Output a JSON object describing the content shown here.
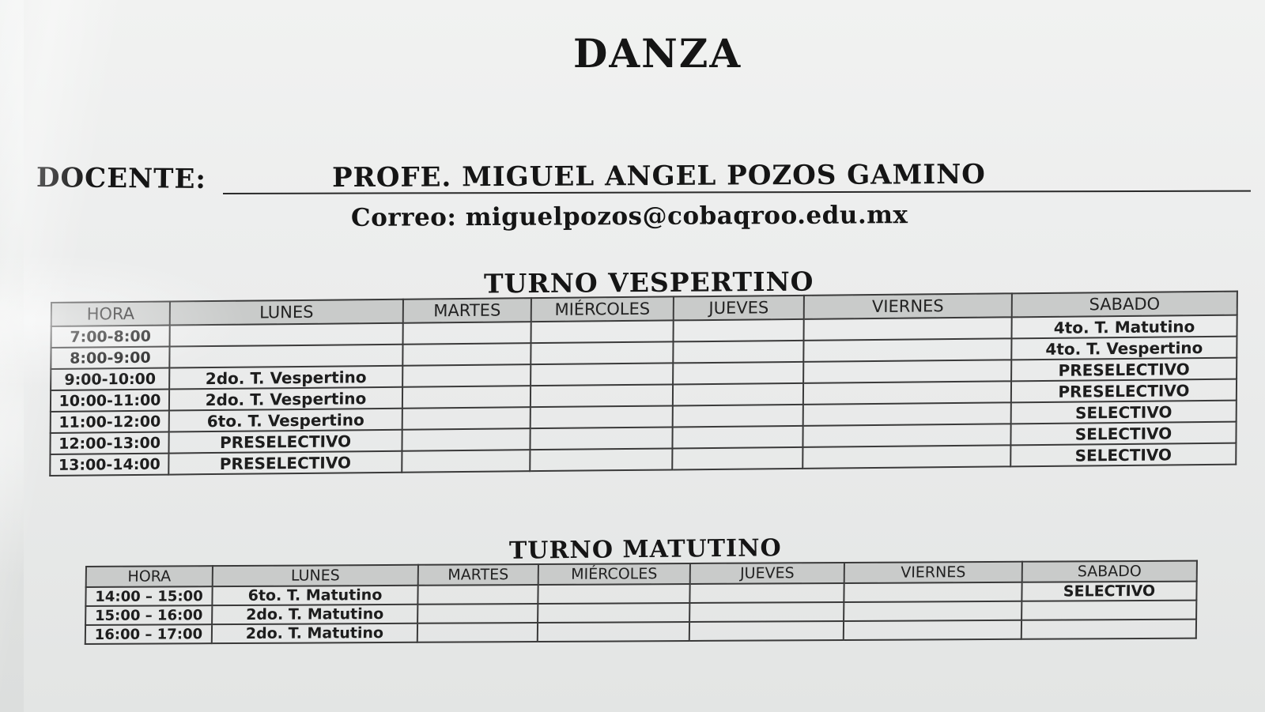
{
  "title": "DANZA",
  "docente": {
    "label": "DOCENTE:",
    "name": "PROFE. MIGUEL ANGEL POZOS GAMINO",
    "email_line": "Correo: miguelpozos@cobaqroo.edu.mx"
  },
  "vespertino": {
    "heading": "TURNO VESPERTINO",
    "headers": [
      "HORA",
      "LUNES",
      "MARTES",
      "MIÉRCOLES",
      "JUEVES",
      "VIERNES",
      "SABADO"
    ],
    "rows": [
      [
        "7:00-8:00",
        "",
        "",
        "",
        "",
        "",
        "4to. T. Matutino"
      ],
      [
        "8:00-9:00",
        "",
        "",
        "",
        "",
        "",
        "4to. T. Vespertino"
      ],
      [
        "9:00-10:00",
        "2do. T. Vespertino",
        "",
        "",
        "",
        "",
        "PRESELECTIVO"
      ],
      [
        "10:00-11:00",
        "2do. T. Vespertino",
        "",
        "",
        "",
        "",
        "PRESELECTIVO"
      ],
      [
        "11:00-12:00",
        "6to. T. Vespertino",
        "",
        "",
        "",
        "",
        "SELECTIVO"
      ],
      [
        "12:00-13:00",
        "PRESELECTIVO",
        "",
        "",
        "",
        "",
        "SELECTIVO"
      ],
      [
        "13:00-14:00",
        "PRESELECTIVO",
        "",
        "",
        "",
        "",
        "SELECTIVO"
      ]
    ]
  },
  "matutino": {
    "heading": "TURNO MATUTINO",
    "headers": [
      "HORA",
      "LUNES",
      "MARTES",
      "MIÉRCOLES",
      "JUEVES",
      "VIERNES",
      "SABADO"
    ],
    "rows": [
      [
        "14:00 – 15:00",
        "6to. T. Matutino",
        "",
        "",
        "",
        "",
        "SELECTIVO"
      ],
      [
        "15:00 – 16:00",
        "2do. T. Matutino",
        "",
        "",
        "",
        "",
        ""
      ],
      [
        "16:00 – 17:00",
        "2do. T. Matutino",
        "",
        "",
        "",
        "",
        ""
      ]
    ]
  }
}
